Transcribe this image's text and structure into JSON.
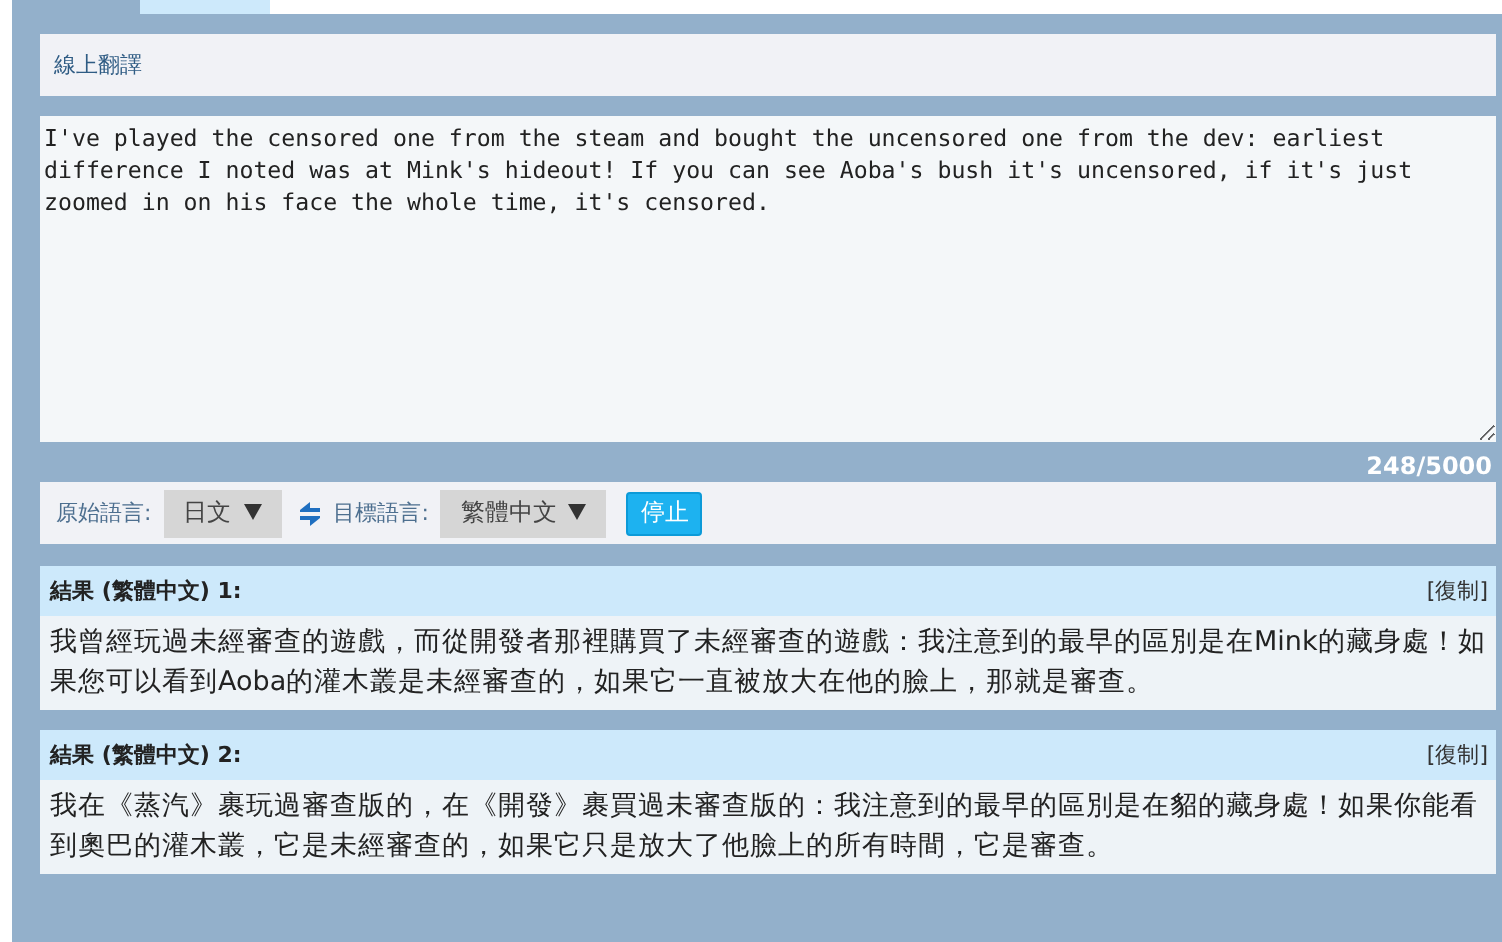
{
  "panel": {
    "title": "線上翻譯"
  },
  "source": {
    "value": "I've played the censored one from the steam and bought the uncensored one from the dev: earliest difference I noted was at Mink's hideout! If you can see Aoba's bush it's uncensored, if it's just zoomed in on his face the whole time, it's censored.",
    "count": "248/5000"
  },
  "languages": {
    "source_label": "原始語言:",
    "source_value": "日文",
    "target_label": "目標語言:",
    "target_value": "繁體中文",
    "stop_button": "停止"
  },
  "results": [
    {
      "title": "結果 (繁體中文) 1:",
      "copy": "[復制]",
      "text": "我曾經玩過未經審查的遊戲，而從開發者那裡購買了未經審查的遊戲：我注意到的最早的區別是在Mink的藏身處！如果您可以看到Aoba的灌木叢是未經審查的，如果它一直被放大在他的臉上，那就是審查。"
    },
    {
      "title": "結果 (繁體中文) 2:",
      "copy": "[復制]",
      "text": "我在《蒸汽》裹玩過審查版的，在《開發》裹買過未審查版的：我注意到的最早的區別是在貂的藏身處！如果你能看到奧巴的灌木叢，它是未經審查的，如果它只是放大了他臉上的所有時間，它是審查。"
    }
  ]
}
